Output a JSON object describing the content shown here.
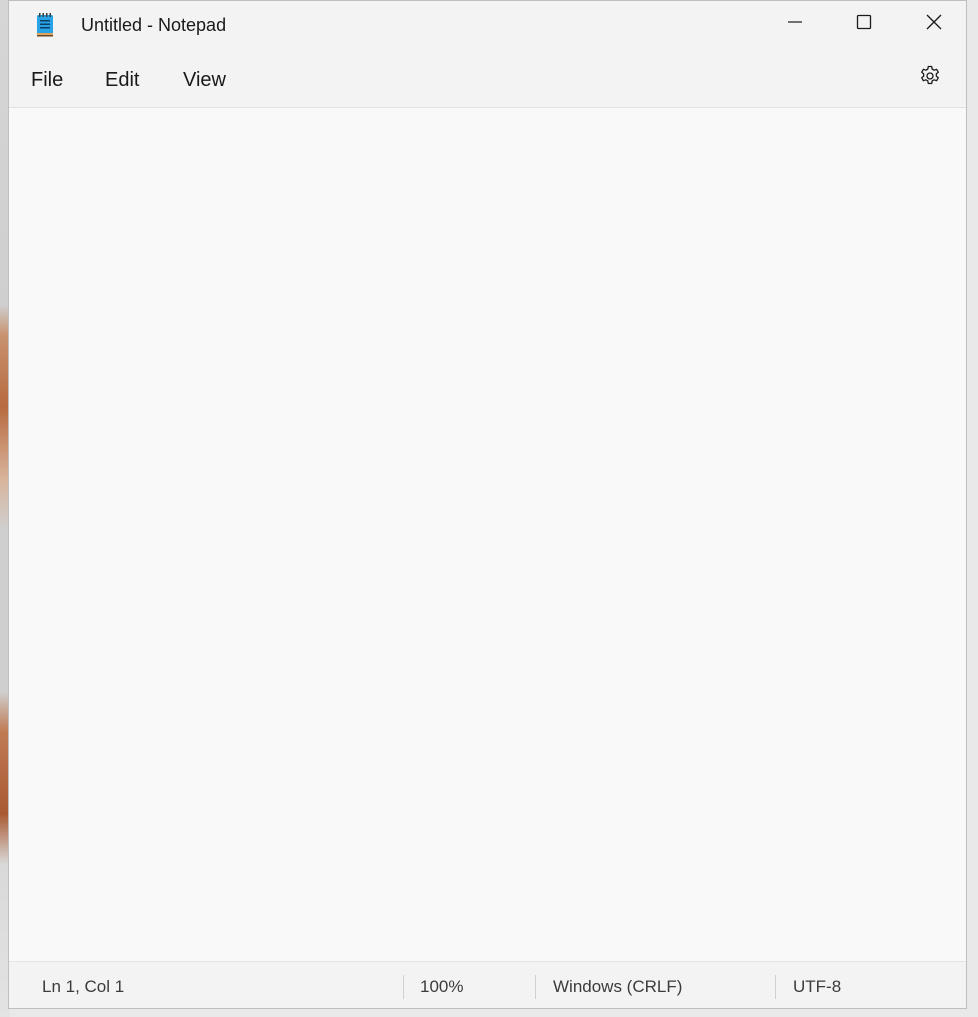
{
  "window": {
    "title": "Untitled - Notepad",
    "app_icon": "notepad-icon"
  },
  "caption_buttons": {
    "minimize_icon": "minimize-icon",
    "maximize_icon": "maximize-icon",
    "close_icon": "close-icon"
  },
  "menu": {
    "items": [
      {
        "label": "File"
      },
      {
        "label": "Edit"
      },
      {
        "label": "View"
      }
    ],
    "settings_icon": "gear-icon"
  },
  "editor": {
    "value": ""
  },
  "status": {
    "position": "Ln 1, Col 1",
    "zoom": "100%",
    "line_ending": "Windows (CRLF)",
    "encoding": "UTF-8"
  },
  "colors": {
    "accent": "#1c8fd9",
    "window_bg": "#f3f3f3",
    "editor_bg": "#f9f9f9"
  }
}
